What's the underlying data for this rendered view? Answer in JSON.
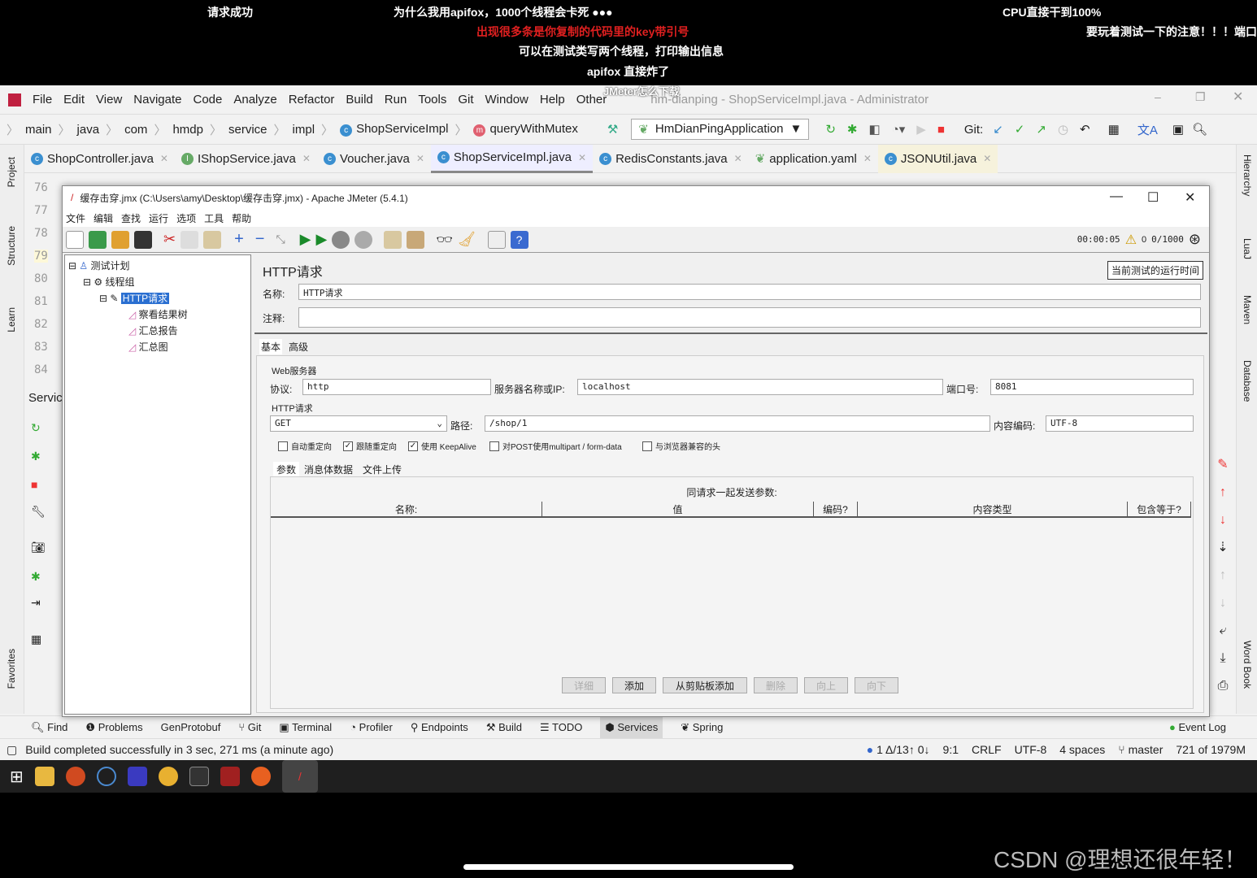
{
  "subtitles": [
    "请求成功",
    "为什么我用apifox，1000个线程会卡死 ●●●",
    "CPU直接干到100%",
    "出现很多条是你复制的代码里的key带引号",
    "要玩着测试一下的注意！！！端口",
    "可以在测试类写两个线程，打印输出信息",
    "apifox 直接炸了",
    "JMeter怎么下载"
  ],
  "ide": {
    "menu": [
      "File",
      "Edit",
      "View",
      "Navigate",
      "Code",
      "Analyze",
      "Refactor",
      "Build",
      "Run",
      "Tools",
      "Git",
      "Window",
      "Help",
      "Other"
    ],
    "window_title": "hm-dianping - ShopServiceImpl.java - Administrator",
    "breadcrumb": [
      "main",
      "java",
      "com",
      "hmdp",
      "service",
      "impl",
      "ShopServiceImpl",
      "queryWithMutex"
    ],
    "run_config": "HmDianPingApplication",
    "git_label": "Git:",
    "tabs": [
      "ShopController.java",
      "IShopService.java",
      "Voucher.java",
      "ShopServiceImpl.java",
      "RedisConstants.java",
      "application.yaml",
      "JSONUtil.java"
    ],
    "active_tab": "ShopServiceImpl.java",
    "line_numbers": [
      "76",
      "77",
      "78",
      "79",
      "80",
      "81",
      "82",
      "83",
      "84"
    ],
    "left_tools": [
      "Project",
      "Structure",
      "Learn",
      "Favorites"
    ],
    "right_tools": [
      "Hierarchy",
      "LuaJ",
      "Maven",
      "Database",
      "Word Book"
    ],
    "services_label": "Servic",
    "tool_windows": [
      "Find",
      "Problems",
      "GenProtobuf",
      "Git",
      "Terminal",
      "Profiler",
      "Endpoints",
      "Build",
      "TODO",
      "Services",
      "Spring"
    ],
    "event_log": "Event Log",
    "status_message": "Build completed successfully in 3 sec, 271 ms (a minute ago)",
    "status_right": [
      "1 Δ/13↑ 0↓",
      "9:1",
      "CRLF",
      "UTF-8",
      "4 spaces",
      "master",
      "721 of 1979M"
    ]
  },
  "jmeter": {
    "title": "缓存击穿.jmx (C:\\Users\\amy\\Desktop\\缓存击穿.jmx) - Apache JMeter (5.4.1)",
    "menu": [
      "文件",
      "编辑",
      "查找",
      "运行",
      "选项",
      "工具",
      "帮助"
    ],
    "timer": "00:00:05",
    "warnings": "0",
    "threads": "0/1000",
    "tooltip": "当前测试的运行时间",
    "tree": [
      "测试计划",
      "线程组",
      "HTTP请求",
      "察看结果树",
      "汇总报告",
      "汇总图"
    ],
    "selected_node": "HTTP请求",
    "panel_title": "HTTP请求",
    "name_label": "名称:",
    "name_value": "HTTP请求",
    "comment_label": "注释:",
    "comment_value": "",
    "tabs": [
      "基本",
      "高级"
    ],
    "web_server_label": "Web服务器",
    "protocol_label": "协议:",
    "protocol_value": "http",
    "server_label": "服务器名称或IP:",
    "server_value": "localhost",
    "port_label": "端口号:",
    "port_value": "8081",
    "http_request_label": "HTTP请求",
    "method": "GET",
    "path_label": "路径:",
    "path_value": "/shop/1",
    "encoding_label": "内容编码:",
    "encoding_value": "UTF-8",
    "checkboxes": [
      {
        "label": "自动重定向",
        "checked": false
      },
      {
        "label": "跟随重定向",
        "checked": true
      },
      {
        "label": "使用 KeepAlive",
        "checked": true
      },
      {
        "label": "对POST使用multipart / form-data",
        "checked": false
      },
      {
        "label": "与浏览器兼容的头",
        "checked": false
      }
    ],
    "sub_tabs": [
      "参数",
      "消息体数据",
      "文件上传"
    ],
    "params_caption": "同请求一起发送参数:",
    "columns": [
      "名称:",
      "值",
      "编码?",
      "内容类型",
      "包含等于?"
    ],
    "buttons": [
      {
        "label": "详细",
        "enabled": false
      },
      {
        "label": "添加",
        "enabled": true
      },
      {
        "label": "从剪贴板添加",
        "enabled": true
      },
      {
        "label": "删除",
        "enabled": false
      },
      {
        "label": "向上",
        "enabled": false
      },
      {
        "label": "向下",
        "enabled": false
      }
    ]
  },
  "watermark": "CSDN @理想还很年轻！"
}
